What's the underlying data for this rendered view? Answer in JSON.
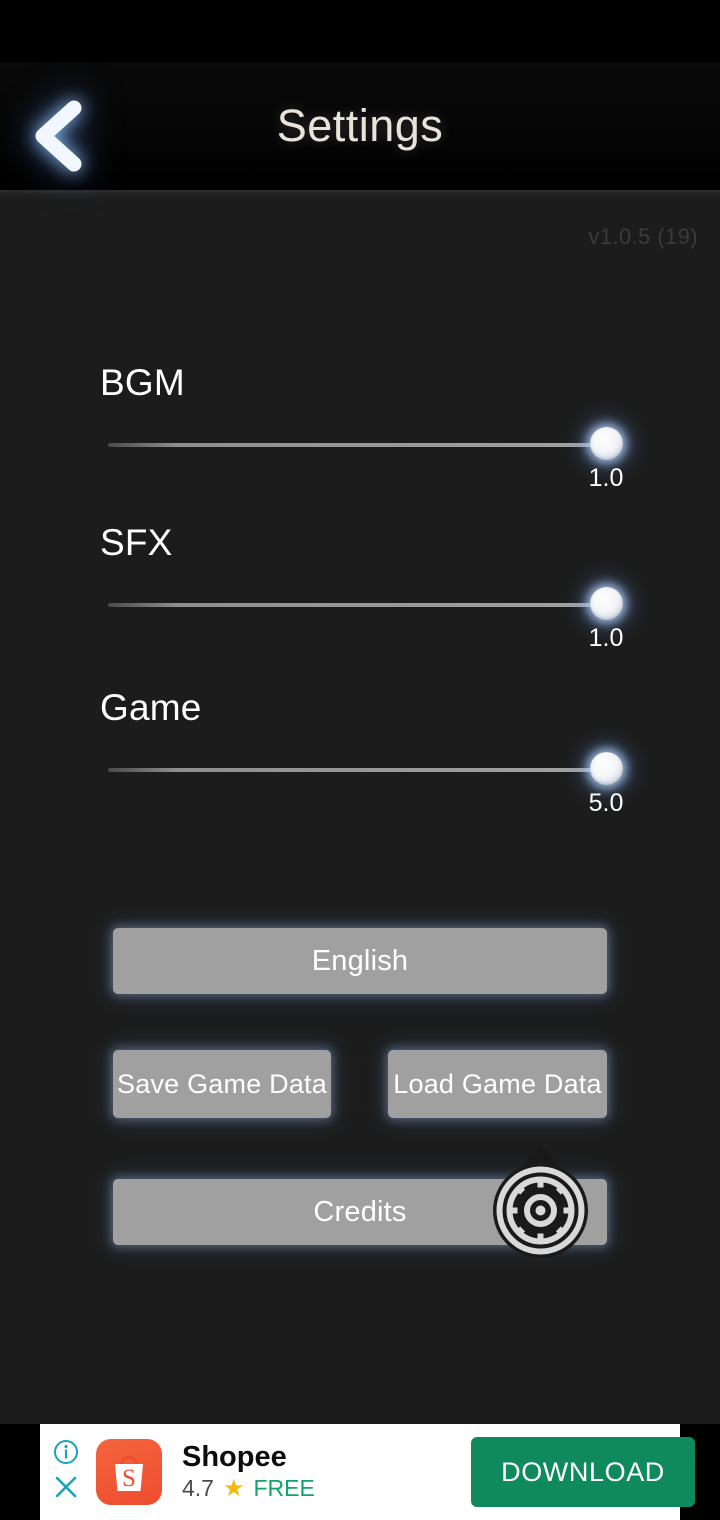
{
  "header": {
    "title": "Settings",
    "back_icon": "chevron-left-icon"
  },
  "version": "v1.0.5 (19)",
  "sliders": [
    {
      "label": "BGM",
      "value": "1.0",
      "fill_ratio": 1.0
    },
    {
      "label": "SFX",
      "value": "1.0",
      "fill_ratio": 1.0
    },
    {
      "label": "Game",
      "value": "5.0",
      "fill_ratio": 1.0
    }
  ],
  "buttons": {
    "language": "English",
    "save": "Save Game Data",
    "load": "Load Game Data",
    "credits": "Credits"
  },
  "overlay_widget": {
    "name": "dial-target-icon",
    "arrow": "triangle-up-icon"
  },
  "ad": {
    "title": "Shopee",
    "rating": "4.7",
    "star": "★",
    "price": "FREE",
    "cta": "DOWNLOAD",
    "info_icon": "info-icon",
    "close_icon": "close-icon",
    "app_icon": "shopee-bag-icon"
  },
  "colors": {
    "background": "#1c1c1c",
    "header": "#000000",
    "button": "#a0a0a0",
    "accent_green": "#0f8a5f",
    "ad_icon_orange": "#ee4d2d",
    "star_yellow": "#f5b715",
    "free_green": "#11a36b",
    "ad_control_teal": "#1aa3bd",
    "knob_glow": "#b9d7ff"
  }
}
